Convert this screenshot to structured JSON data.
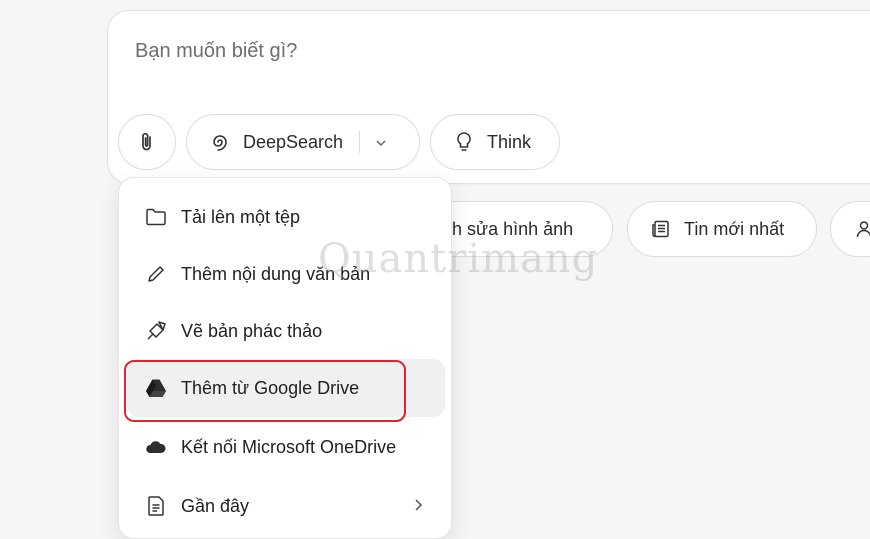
{
  "composer": {
    "placeholder": "Bạn muốn biết gì?",
    "deepsearch_label": "DeepSearch",
    "think_label": "Think"
  },
  "chips": [
    {
      "label": "Chỉnh sửa hình ảnh",
      "visible_label": "nh sửa hình ảnh",
      "icon": "image-edit-icon"
    },
    {
      "label": "Tin mới nhất",
      "icon": "newspaper-icon"
    },
    {
      "label": "",
      "icon": "person-icon"
    }
  ],
  "menu": {
    "items": [
      {
        "label": "Tải lên một tệp",
        "icon": "folder-icon"
      },
      {
        "label": "Thêm nội dung văn bản",
        "icon": "pencil-icon"
      },
      {
        "label": "Vẽ bản phác thảo",
        "icon": "brush-icon"
      },
      {
        "label": "Thêm từ Google Drive",
        "icon": "google-drive-icon",
        "highlighted": true
      },
      {
        "label": "Kết nối Microsoft OneDrive",
        "icon": "onedrive-icon"
      },
      {
        "label": "Gần đây",
        "icon": "document-icon",
        "has_submenu": true
      }
    ]
  },
  "watermark": "Quantrimang",
  "colors": {
    "highlight_border": "#e0262b",
    "highlight_bg": "#f0f0f0",
    "placeholder_text": "#6e6e6e"
  }
}
